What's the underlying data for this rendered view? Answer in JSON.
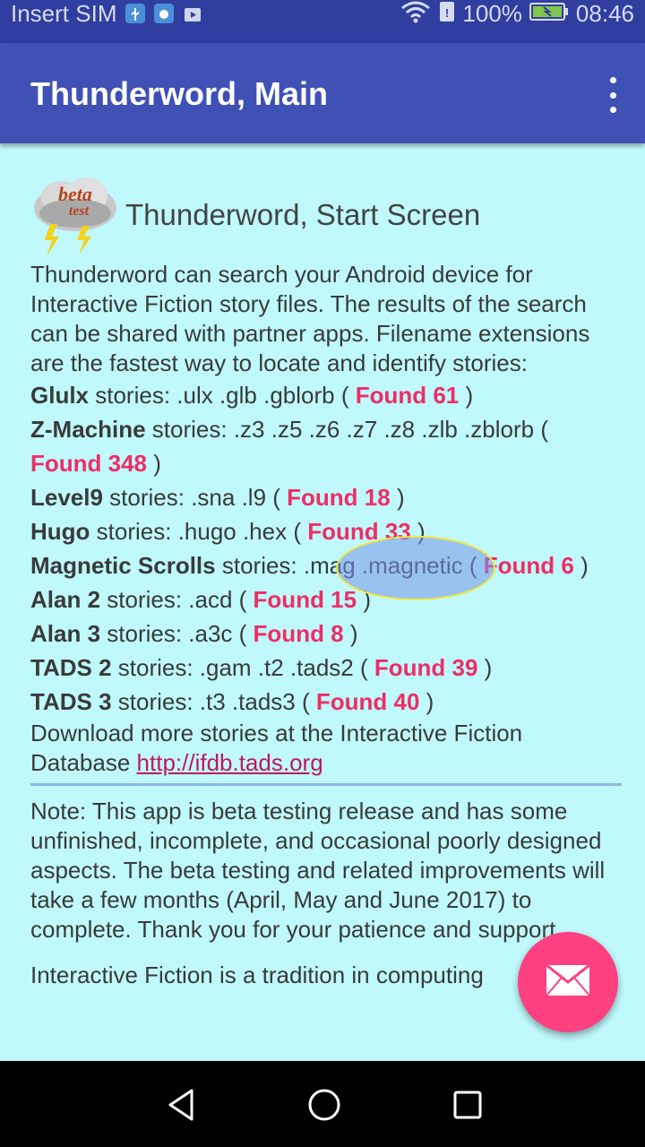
{
  "status_bar": {
    "carrier": "Insert SIM",
    "battery": "100%",
    "time": "08:46"
  },
  "app_bar": {
    "title": "Thunderword, Main",
    "overflow_icon": "more-vert-icon"
  },
  "header": {
    "logo_text_1": "beta",
    "logo_text_2": "test",
    "title": "Thunderword, Start Screen"
  },
  "intro": "Thunderword can search your Android device for Interactive Fiction story files. The results of the search can be shared with partner apps. Filename extensions are the fastest way to locate and identify stories:",
  "formats": [
    {
      "name": "Glulx",
      "ext": " stories: .ulx .glb .gblorb ",
      "found": "Found 61"
    },
    {
      "name": "Z-Machine",
      "ext": " stories: .z3 .z5 .z6 .z7 .z8 .zlb .zblorb ",
      "found": "Found 348"
    },
    {
      "name": "Level9",
      "ext": " stories: .sna .l9 ",
      "found": "Found 18"
    },
    {
      "name": "Hugo",
      "ext": " stories: .hugo .hex ",
      "found": "Found 33"
    },
    {
      "name": "Magnetic Scrolls",
      "ext": " stories: .mag .magnetic ",
      "found": "Found 6"
    },
    {
      "name": "Alan 2",
      "ext": " stories: .acd ",
      "found": "Found 15"
    },
    {
      "name": "Alan 3",
      "ext": " stories: .a3c ",
      "found": "Found 8"
    },
    {
      "name": "TADS 2",
      "ext": " stories: .gam .t2 .tads2 ",
      "found": "Found 39"
    },
    {
      "name": "TADS 3",
      "ext": " stories: .t3 .tads3 ",
      "found": "Found 40"
    }
  ],
  "download": {
    "text": "Download more stories at the Interactive Fiction Database ",
    "link": "http://ifdb.tads.org"
  },
  "note": "Note: This app is beta testing release and has some unfinished, incomplete, and occasional poorly designed aspects. The beta testing and related improvements will take a few months (April, May and June 2017) to complete. Thank you for your patience and support.",
  "more": "Interactive Fiction is a tradition in computing",
  "fab": {
    "icon": "email-icon"
  },
  "navbar": {
    "back": "back-icon",
    "home": "home-icon",
    "recents": "recents-icon"
  },
  "colors": {
    "app_bar": "#3f51b5",
    "status_bar": "#303f9f",
    "background": "#bff9fb",
    "found": "#ee2d66",
    "fab": "#ff4081"
  }
}
